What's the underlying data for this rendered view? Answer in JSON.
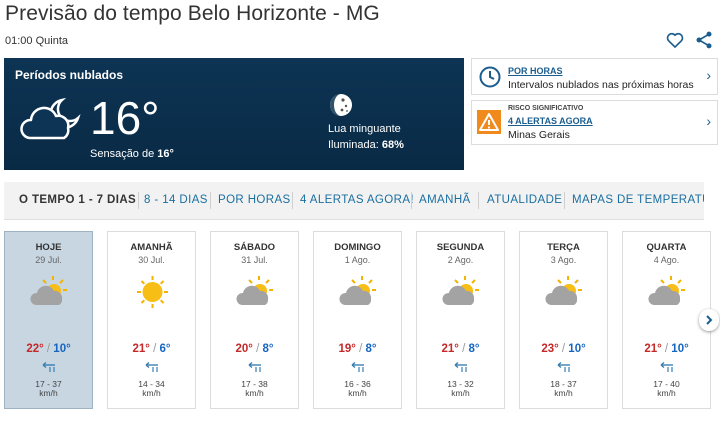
{
  "page": {
    "title": "Previsão do tempo Belo Horizonte - MG",
    "subtitle": "01:00 Quinta"
  },
  "icons": [
    "heart-icon",
    "share-icon",
    "partly-cloudy-night-icon",
    "moon-icon",
    "clock-icon",
    "warning-icon",
    "chevron-right-icon",
    "partly-cloudy-icon",
    "sunny-icon",
    "wind-icon"
  ],
  "current": {
    "condition": "Períodos nublados",
    "temp": "16°",
    "feels_label": "Sensação de",
    "feels_value": "16°",
    "moon_phase": "Lua minguante",
    "illum_label": "Iluminada:",
    "illum_value": "68%"
  },
  "side_cards": {
    "hourly": {
      "link": "POR HORAS",
      "text": "Intervalos nublados nas próximas horas"
    },
    "alerts": {
      "small": "RISCO SIGNIFICATIVO",
      "link": "4 ALERTAS AGORA",
      "text": "Minas Gerais"
    }
  },
  "tabs": [
    {
      "label": "O TEMPO 1 - 7 DIAS"
    },
    {
      "label": "8 - 14 DIAS"
    },
    {
      "label": "POR HORAS"
    },
    {
      "label": "4 ALERTAS AGORA!"
    },
    {
      "label": "AMANHÃ"
    },
    {
      "label": "ATUALIDADE"
    },
    {
      "label": "MAPAS DE TEMPERATURA"
    }
  ],
  "days": [
    {
      "name": "HOJE",
      "date": "29 Jul.",
      "icon": "partly-cloudy-icon",
      "max": "22°",
      "min": "10°",
      "wind": "17 - 37",
      "unit": "km/h"
    },
    {
      "name": "AMANHÃ",
      "date": "30 Jul.",
      "icon": "sunny-icon",
      "max": "21°",
      "min": "6°",
      "wind": "14 - 34",
      "unit": "km/h"
    },
    {
      "name": "SÁBADO",
      "date": "31 Jul.",
      "icon": "partly-cloudy-icon",
      "max": "20°",
      "min": "8°",
      "wind": "17 - 38",
      "unit": "km/h"
    },
    {
      "name": "DOMINGO",
      "date": "1 Ago.",
      "icon": "partly-cloudy-icon",
      "max": "19°",
      "min": "8°",
      "wind": "16 - 36",
      "unit": "km/h"
    },
    {
      "name": "SEGUNDA",
      "date": "2 Ago.",
      "icon": "partly-cloudy-icon",
      "max": "21°",
      "min": "8°",
      "wind": "13 - 32",
      "unit": "km/h"
    },
    {
      "name": "TERÇA",
      "date": "3 Ago.",
      "icon": "partly-cloudy-icon",
      "max": "23°",
      "min": "10°",
      "wind": "18 - 37",
      "unit": "km/h"
    },
    {
      "name": "QUARTA",
      "date": "4 Ago.",
      "icon": "partly-cloudy-icon",
      "max": "21°",
      "min": "10°",
      "wind": "17 - 40",
      "unit": "km/h"
    }
  ],
  "colors": {
    "accent": "#1a6fa0",
    "max_temp": "#c62828",
    "min_temp": "#1565c0",
    "card_bg": "#0d3454",
    "today_bg": "#c7d6e1",
    "warning": "#f08a1c"
  }
}
